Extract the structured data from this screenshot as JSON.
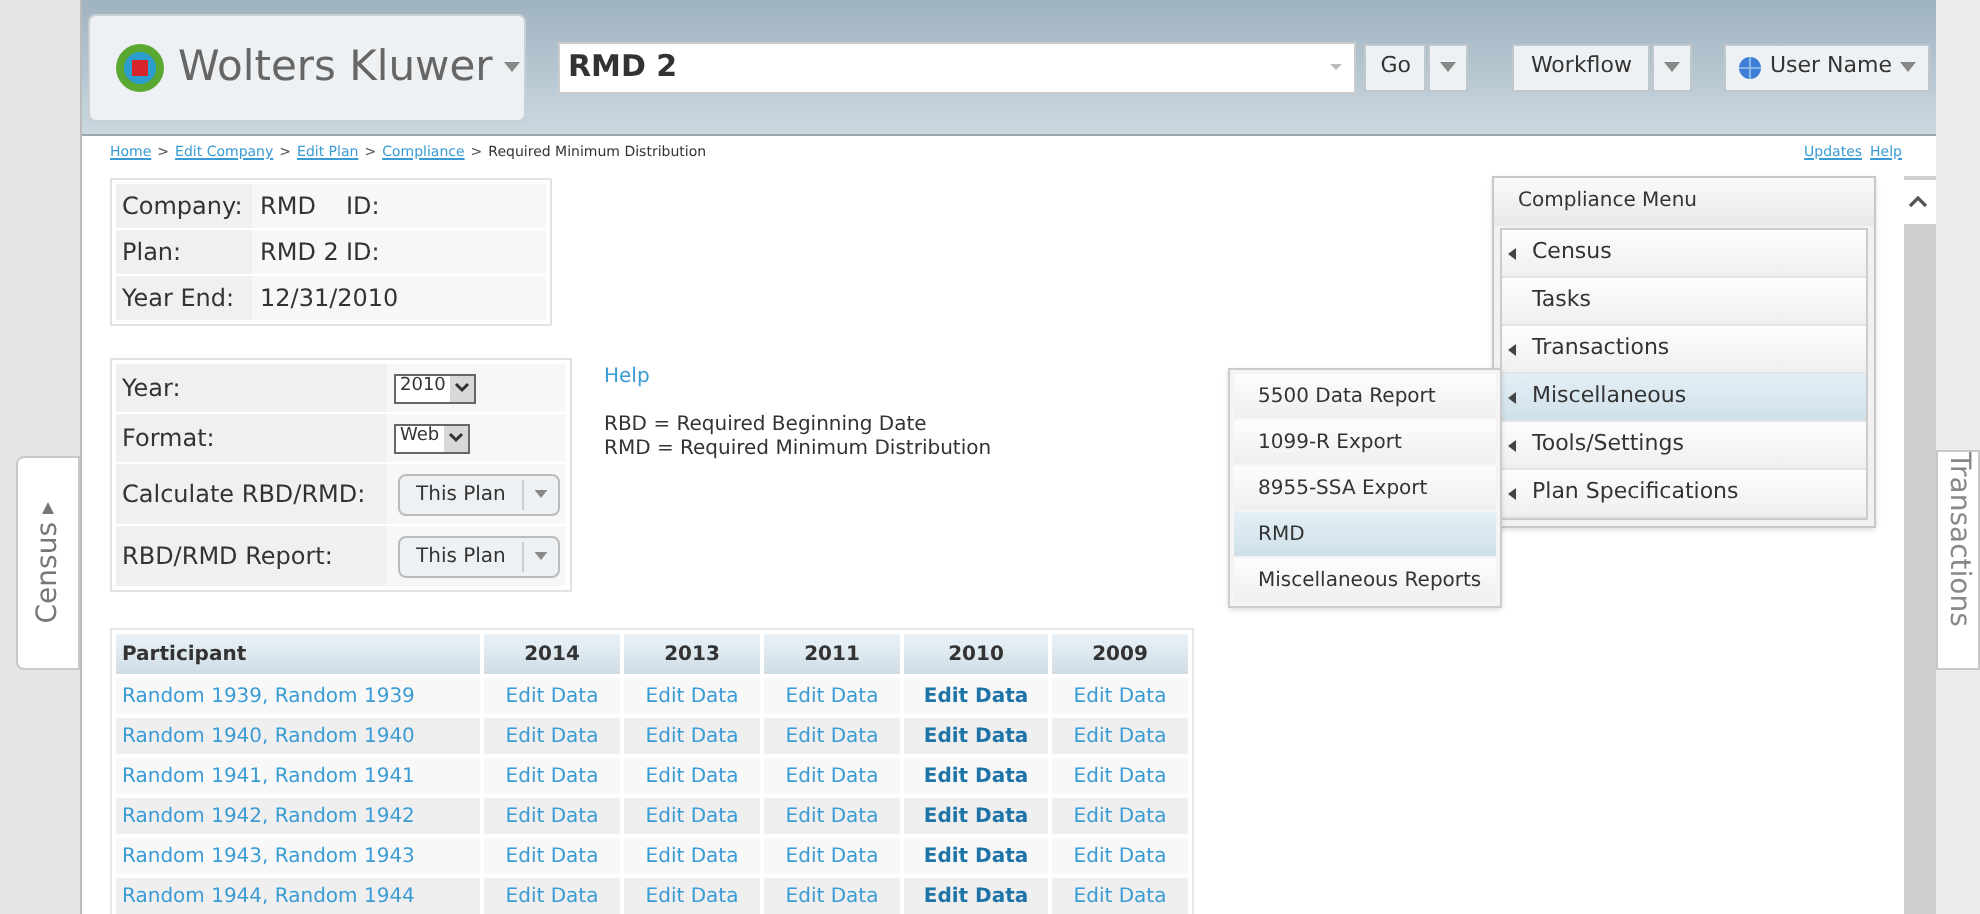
{
  "header": {
    "logo_text": "Wolters Kluwer",
    "search": {
      "value": "RMD 2"
    },
    "go_button": "Go",
    "workflow_button": "Workflow",
    "user_button": "User Name"
  },
  "breadcrumb": {
    "separator": ">",
    "links": [
      "Home",
      "Edit Company",
      "Edit Plan",
      "Compliance"
    ],
    "current": "Required Minimum Distribution"
  },
  "top_links": [
    "Updates",
    "Help"
  ],
  "info": [
    {
      "label": "Company:",
      "value": "RMD",
      "id_label": "ID:"
    },
    {
      "label": "Plan:",
      "value": "RMD 2",
      "id_label": "ID:"
    },
    {
      "label": "Year End:",
      "value": "12/31/2010"
    }
  ],
  "settings": [
    {
      "kind": "select",
      "label": "Year:",
      "value": "2010"
    },
    {
      "kind": "select",
      "label": "Format:",
      "value": "Web"
    },
    {
      "kind": "split",
      "label": "Calculate RBD/RMD:",
      "value": "This Plan"
    },
    {
      "kind": "split",
      "label": "RBD/RMD Report:",
      "value": "This Plan"
    }
  ],
  "help": {
    "link": "Help",
    "notes": [
      "RBD = Required Beginning Date",
      "RMD = Required Minimum Distribution"
    ]
  },
  "table": {
    "columns": [
      {
        "label": "Participant",
        "current": false
      },
      {
        "label": "2014",
        "current": false
      },
      {
        "label": "2013",
        "current": false
      },
      {
        "label": "2011",
        "current": false
      },
      {
        "label": "2010",
        "current": true
      },
      {
        "label": "2009",
        "current": false
      }
    ],
    "rows": [
      [
        "Random 1939, Random 1939",
        "Edit Data",
        "Edit Data",
        "Edit Data",
        "Edit Data",
        "Edit Data"
      ],
      [
        "Random 1940, Random 1940",
        "Edit Data",
        "Edit Data",
        "Edit Data",
        "Edit Data",
        "Edit Data"
      ],
      [
        "Random 1941, Random 1941",
        "Edit Data",
        "Edit Data",
        "Edit Data",
        "Edit Data",
        "Edit Data"
      ],
      [
        "Random 1942, Random 1942",
        "Edit Data",
        "Edit Data",
        "Edit Data",
        "Edit Data",
        "Edit Data"
      ],
      [
        "Random 1943, Random 1943",
        "Edit Data",
        "Edit Data",
        "Edit Data",
        "Edit Data",
        "Edit Data"
      ],
      [
        "Random 1944, Random 1944",
        "Edit Data",
        "Edit Data",
        "Edit Data",
        "Edit Data",
        "Edit Data"
      ]
    ]
  },
  "compliance_menu": {
    "title": "Compliance Menu",
    "items": [
      {
        "label": "Census",
        "has_submenu": true,
        "selected": false
      },
      {
        "label": "Tasks",
        "has_submenu": false,
        "selected": false
      },
      {
        "label": "Transactions",
        "has_submenu": true,
        "selected": false
      },
      {
        "label": "Miscellaneous",
        "has_submenu": true,
        "selected": true
      },
      {
        "label": "Tools/Settings",
        "has_submenu": true,
        "selected": false
      },
      {
        "label": "Plan Specifications",
        "has_submenu": true,
        "selected": false
      }
    ]
  },
  "submenu": [
    {
      "label": "5500 Data Report",
      "selected": false
    },
    {
      "label": "1099-R Export",
      "selected": false
    },
    {
      "label": "8955-SSA Export",
      "selected": false
    },
    {
      "label": "RMD",
      "selected": true
    },
    {
      "label": "Miscellaneous Reports",
      "selected": false
    }
  ],
  "side_tabs": {
    "left": "Census",
    "right": "Transactions"
  }
}
